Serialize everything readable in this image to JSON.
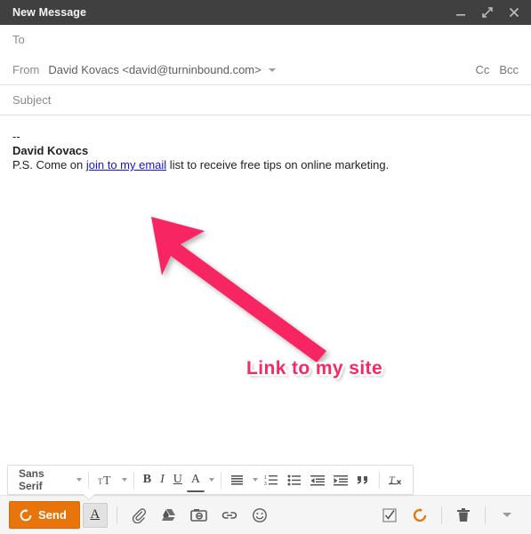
{
  "window": {
    "title": "New Message",
    "controls": [
      {
        "name": "minimize",
        "icon": "minimize-icon"
      },
      {
        "name": "expand",
        "icon": "expand-icon"
      },
      {
        "name": "close",
        "icon": "close-icon"
      }
    ]
  },
  "fields": {
    "to": {
      "label": "To",
      "value": ""
    },
    "from": {
      "label": "From",
      "value": "David Kovacs <david@turninbound.com>"
    },
    "subject": {
      "label": "Subject",
      "value": ""
    },
    "cc": "Cc",
    "bcc": "Bcc"
  },
  "body": {
    "dashes": "--",
    "signature_name": "David Kovacs",
    "ps_before": "P.S. Come on ",
    "ps_link": "join to my email",
    "ps_after": " list to receive free tips on online marketing."
  },
  "annotation": {
    "label": "Link to my site",
    "color": "#F72864",
    "arrow_icon": "arrow-up-left-icon"
  },
  "format_toolbar": {
    "font_name": "Sans Serif",
    "items": [
      {
        "name": "font-family-selector",
        "label": "Sans Serif",
        "icon": "chevron-down-icon"
      },
      {
        "name": "font-size-button",
        "label": "",
        "icon": "text-size-icon"
      },
      {
        "name": "bold-button",
        "label": "B",
        "icon": "bold-icon"
      },
      {
        "name": "italic-button",
        "label": "I",
        "icon": "italic-icon"
      },
      {
        "name": "underline-button",
        "label": "U",
        "icon": "underline-icon"
      },
      {
        "name": "text-color-button",
        "label": "A",
        "icon": "text-color-icon"
      },
      {
        "name": "align-button",
        "label": "",
        "icon": "align-icon"
      },
      {
        "name": "numbered-list-button",
        "label": "",
        "icon": "numbered-list-icon"
      },
      {
        "name": "bulleted-list-button",
        "label": "",
        "icon": "bulleted-list-icon"
      },
      {
        "name": "outdent-button",
        "label": "",
        "icon": "outdent-icon"
      },
      {
        "name": "indent-button",
        "label": "",
        "icon": "indent-icon"
      },
      {
        "name": "quote-button",
        "label": "",
        "icon": "quote-icon"
      },
      {
        "name": "remove-formatting-button",
        "label": "",
        "icon": "remove-formatting-icon"
      }
    ]
  },
  "action_bar": {
    "send_label": "Send",
    "send_color": "#E8740C",
    "left_items": [
      {
        "name": "formatting-options",
        "icon": "underlined-a-icon",
        "label": "A"
      },
      {
        "name": "attach-file",
        "icon": "paperclip-icon"
      },
      {
        "name": "insert-drive",
        "icon": "google-drive-icon"
      },
      {
        "name": "insert-photo",
        "icon": "camera-icon"
      },
      {
        "name": "insert-link",
        "icon": "link-icon"
      },
      {
        "name": "insert-emoji",
        "icon": "emoji-icon"
      }
    ],
    "right_items": [
      {
        "name": "confirm-tracking",
        "icon": "checkbox-checked-icon"
      },
      {
        "name": "tracking-status",
        "icon": "circular-arrow-icon"
      },
      {
        "name": "discard-draft",
        "icon": "trash-icon"
      },
      {
        "name": "more-options",
        "icon": "chevron-down-icon"
      }
    ]
  }
}
